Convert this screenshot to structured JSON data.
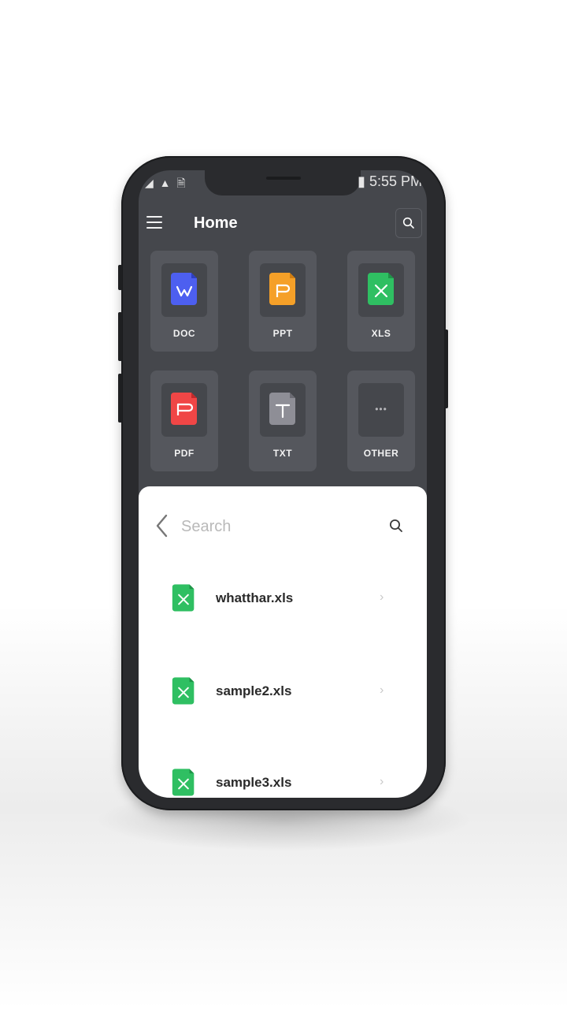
{
  "status_bar": {
    "left_icons": "◢ ▲ 🗎",
    "right_text": "▮ 5:55 PM"
  },
  "header": {
    "title": "Home",
    "menu_icon": "hamburger-icon",
    "search_icon": "search-icon"
  },
  "categories": [
    {
      "label": "DOC",
      "icon": "doc-icon",
      "color": "#4d5ff0",
      "glyph": "W"
    },
    {
      "label": "PPT",
      "icon": "ppt-icon",
      "color": "#f5a028",
      "glyph": "P"
    },
    {
      "label": "XLS",
      "icon": "xls-icon",
      "color": "#2fbf62",
      "glyph": "X"
    },
    {
      "label": "PDF",
      "icon": "pdf-icon",
      "color": "#f04646",
      "glyph": "P"
    },
    {
      "label": "TXT",
      "icon": "txt-icon",
      "color": "#8e8e96",
      "glyph": "T"
    },
    {
      "label": "OTHER",
      "icon": "more-icon",
      "glyph": "•••"
    }
  ],
  "search_sheet": {
    "placeholder": "Search",
    "results": [
      {
        "name": "whatthar.xls",
        "icon": "xls-icon"
      },
      {
        "name": "sample2.xls",
        "icon": "xls-icon"
      },
      {
        "name": "sample3.xls",
        "icon": "xls-icon"
      }
    ]
  },
  "colors": {
    "screen_bg": "#45474c",
    "tile_bg": "#55575d",
    "xls_green": "#2fbf62"
  }
}
